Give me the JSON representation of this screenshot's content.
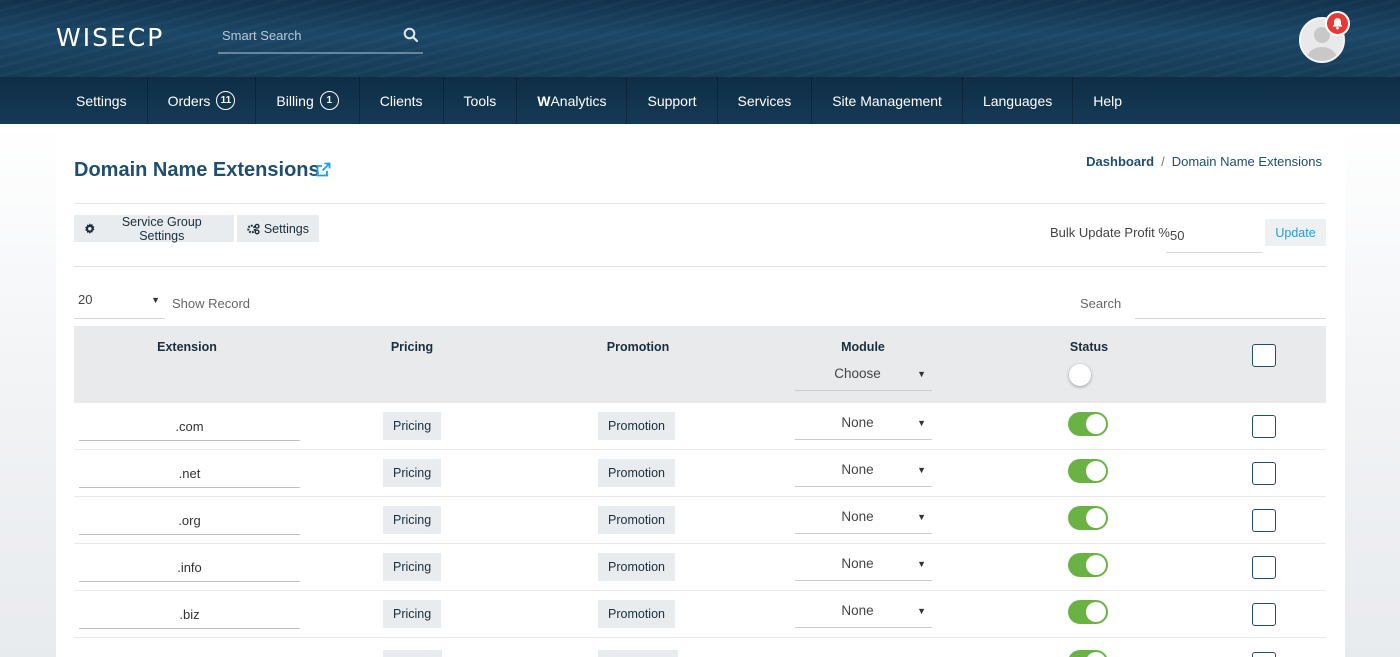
{
  "header": {
    "logo": "WISECP",
    "search_placeholder": "Smart Search",
    "notification_icon": "bell-icon"
  },
  "nav": [
    {
      "label": "Settings"
    },
    {
      "label": "Orders",
      "count": "11"
    },
    {
      "label": "Billing",
      "count": "1"
    },
    {
      "label": "Clients"
    },
    {
      "label": "Tools"
    },
    {
      "label_bold": "W",
      "label": "Analytics"
    },
    {
      "label": "Support"
    },
    {
      "label": "Services"
    },
    {
      "label": "Site Management"
    },
    {
      "label": "Languages"
    },
    {
      "label": "Help"
    }
  ],
  "page": {
    "title": "Domain Name Extensions",
    "breadcrumb": {
      "home": "Dashboard",
      "separator": "/",
      "current": "Domain Name Extensions"
    }
  },
  "toolbar": {
    "service_group_settings": "Service Group Settings",
    "settings": "Settings",
    "bulk_label": "Bulk Update Profit %",
    "bulk_value": "50",
    "update_button": "Update"
  },
  "table_controls": {
    "records_value": "20",
    "show_record_label": "Show Record",
    "search_label": "Search"
  },
  "table": {
    "columns": [
      "Extension",
      "Pricing",
      "Promotion",
      "Module",
      "Status"
    ],
    "module_filter": "Choose",
    "rows": [
      {
        "extension": ".com",
        "pricing": "Pricing",
        "promotion": "Promotion",
        "module": "None",
        "status": true
      },
      {
        "extension": ".net",
        "pricing": "Pricing",
        "promotion": "Promotion",
        "module": "None",
        "status": true
      },
      {
        "extension": ".org",
        "pricing": "Pricing",
        "promotion": "Promotion",
        "module": "None",
        "status": true
      },
      {
        "extension": ".info",
        "pricing": "Pricing",
        "promotion": "Promotion",
        "module": "None",
        "status": true
      },
      {
        "extension": ".biz",
        "pricing": "Pricing",
        "promotion": "Promotion",
        "module": "None",
        "status": true
      }
    ]
  },
  "colors": {
    "header_bg": "#163c58",
    "title": "#1f4e6e",
    "toggle_on": "#6bb244",
    "badge": "#e53935",
    "update_text": "#1ba1e0"
  }
}
